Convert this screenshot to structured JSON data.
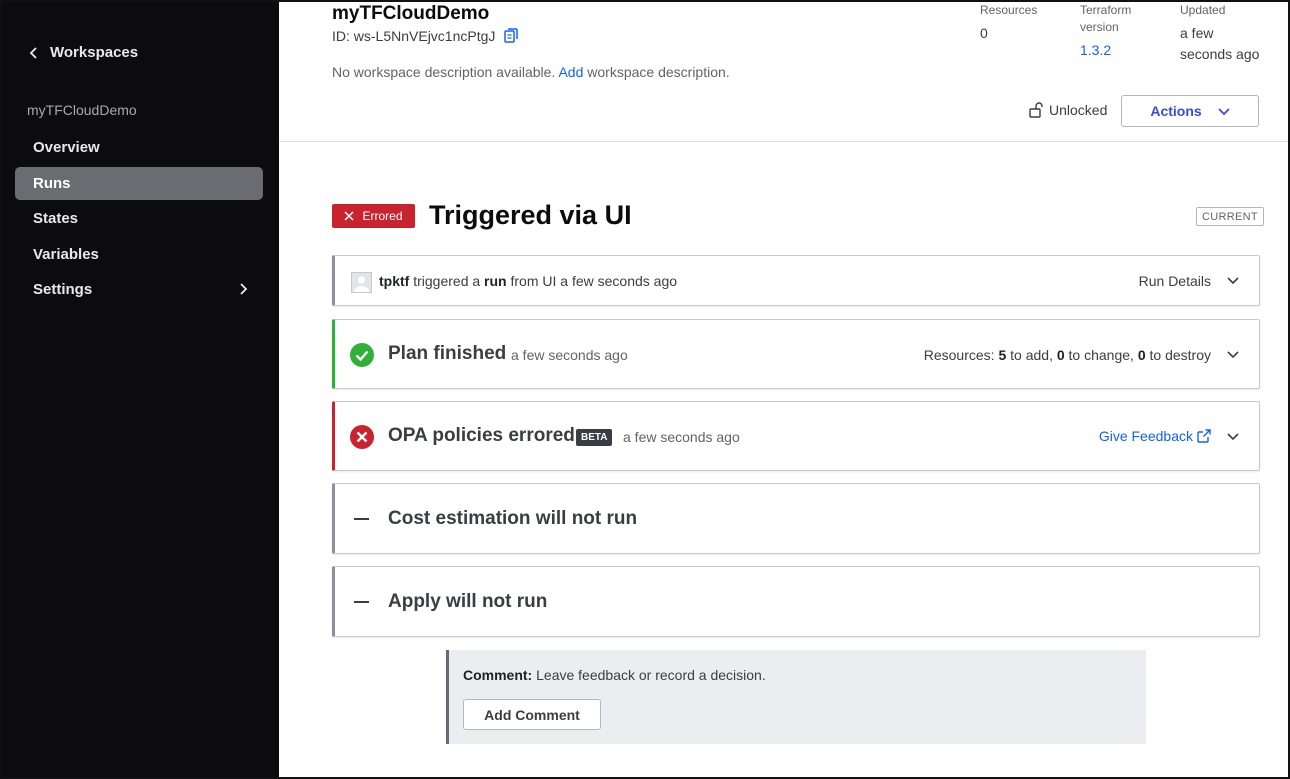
{
  "sidebar": {
    "back_label": "Workspaces",
    "workspace_name": "myTFCloudDemo",
    "items": [
      {
        "label": "Overview",
        "active": false
      },
      {
        "label": "Runs",
        "active": true
      },
      {
        "label": "States",
        "active": false
      },
      {
        "label": "Variables",
        "active": false
      },
      {
        "label": "Settings",
        "active": false,
        "has_submenu": true
      }
    ]
  },
  "header": {
    "title": "myTFCloudDemo",
    "id_label": "ID: ws-L5NnVEjvc1ncPtgJ",
    "description_prefix": "No workspace description available.",
    "description_link": "Add",
    "description_suffix": "workspace description.",
    "meta": {
      "resources_label": "Resources",
      "resources_value": "0",
      "terraform_label_1": "Terraform",
      "terraform_label_2": "version",
      "terraform_value": "1.3.2",
      "updated_label": "Updated",
      "updated_value_1": "a few",
      "updated_value_2": "seconds ago"
    },
    "lock_status": "Unlocked",
    "actions_label": "Actions"
  },
  "run": {
    "status_badge": "Errored",
    "title": "Triggered via UI",
    "current_tag": "CURRENT",
    "triggered": {
      "user": "tpktf",
      "text_1": "triggered a",
      "run_word": "run",
      "text_2": "from UI a few seconds ago",
      "details_label": "Run Details"
    },
    "plan": {
      "title": "Plan finished",
      "time": "a few seconds ago",
      "resources_label": "Resources:",
      "add_count": "5",
      "add_text": "to add,",
      "change_count": "0",
      "change_text": "to change,",
      "destroy_count": "0",
      "destroy_text": "to destroy"
    },
    "opa": {
      "title": "OPA policies errored",
      "beta": "BETA",
      "time": "a few seconds ago",
      "feedback_label": "Give Feedback"
    },
    "cost": {
      "title": "Cost estimation will not run"
    },
    "apply": {
      "title": "Apply will not run"
    }
  },
  "comment": {
    "label": "Comment:",
    "placeholder": "Leave feedback or record a decision.",
    "button_label": "Add Comment"
  },
  "colors": {
    "sidebar_bg": "#0c0c0e",
    "active_nav": "#6b6c71",
    "error": "#c8232f",
    "success": "#2eb039",
    "link": "#1060ff",
    "actions_text": "#3b49e0"
  },
  "icons": [
    "chevron-left-icon",
    "chevron-right-icon",
    "copy-icon",
    "unlock-icon",
    "chevron-down-icon",
    "x-icon",
    "user-avatar-icon",
    "check-circle-icon",
    "x-circle-icon",
    "external-link-icon",
    "dash-icon"
  ]
}
